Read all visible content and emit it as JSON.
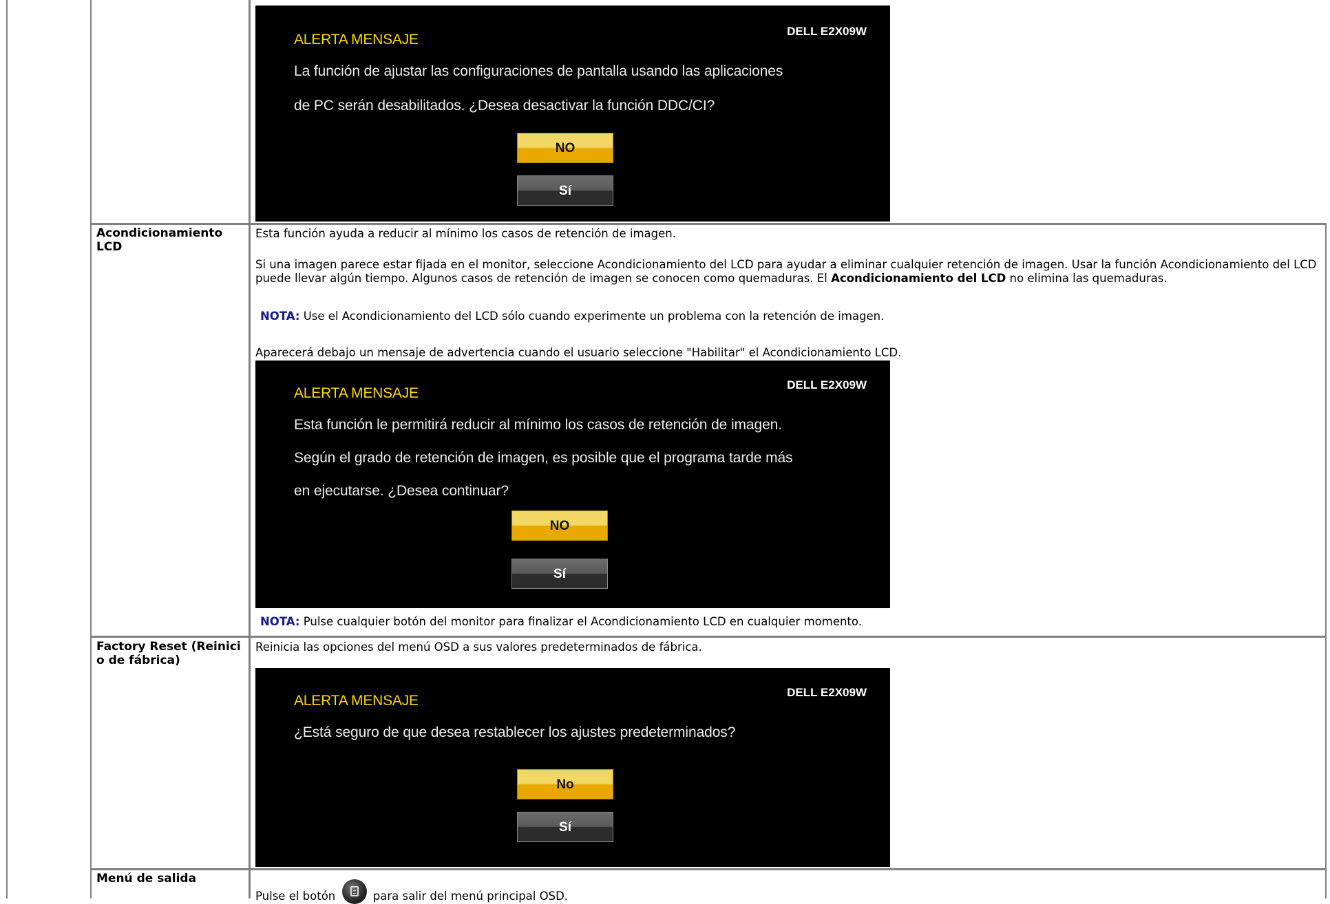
{
  "osd_common": {
    "title": "ALERTA MENSAJE",
    "model": "DELL E2X09W"
  },
  "ddc": {
    "osd_line1": "La función de ajustar las configuraciones de pantalla usando las aplicaciones",
    "osd_line2": "de PC serán desabilitados. ¿Desea desactivar la función DDC/CI?",
    "btn_no": "NO",
    "btn_si": "Sí"
  },
  "lcd": {
    "label": "Acondicionamiento LCD",
    "desc1": "Esta función ayuda a reducir al mínimo los casos de retención de imagen.",
    "desc2_a": "Si una imagen parece estar fijada en el monitor, seleccione Acondicionamiento del LCD para ayudar a eliminar cualquier retención de imagen. Usar la función Acondicionamiento del LCD puede llevar algún tiempo. Algunos casos de retención de imagen se conocen como quemaduras. El ",
    "desc2_bold": "Acondicionamiento del LCD",
    "desc2_b": " no elimina las quemaduras.",
    "note1_label": "NOTA:",
    "note1_text": " Use el Acondicionamiento del LCD sólo cuando experimente un problema con la retención de imagen.",
    "warning_intro": "Aparecerá debajo un mensaje de advertencia cuando el usuario seleccione \"Habilitar\" el Acondicionamiento LCD.",
    "osd_line1": "Esta función le permitirá reducir al mínimo los casos de retención de imagen.",
    "osd_line2": "Según el grado de retención de imagen, es posible que el programa tarde más",
    "osd_line3": "en ejecutarse. ¿Desea continuar?",
    "btn_no": "NO",
    "btn_si": "Sí",
    "note2_label": "NOTA:",
    "note2_text": " Pulse cualquier botón del monitor para finalizar el Acondicionamiento LCD en cualquier momento."
  },
  "reset": {
    "label": "Factory Reset (Reinicio de fábrica)",
    "desc": "Reinicia las opciones del menú OSD a sus valores predeterminados de fábrica.",
    "osd_line1": "¿Está seguro de que desea restablecer los ajustes predeterminados?",
    "btn_no": "No",
    "btn_si": "Sí"
  },
  "exit": {
    "label": "Menú de salida",
    "text_before": "Pulse el botón",
    "text_after": "para salir del menú principal OSD.",
    "icon": "menu-button-icon"
  }
}
